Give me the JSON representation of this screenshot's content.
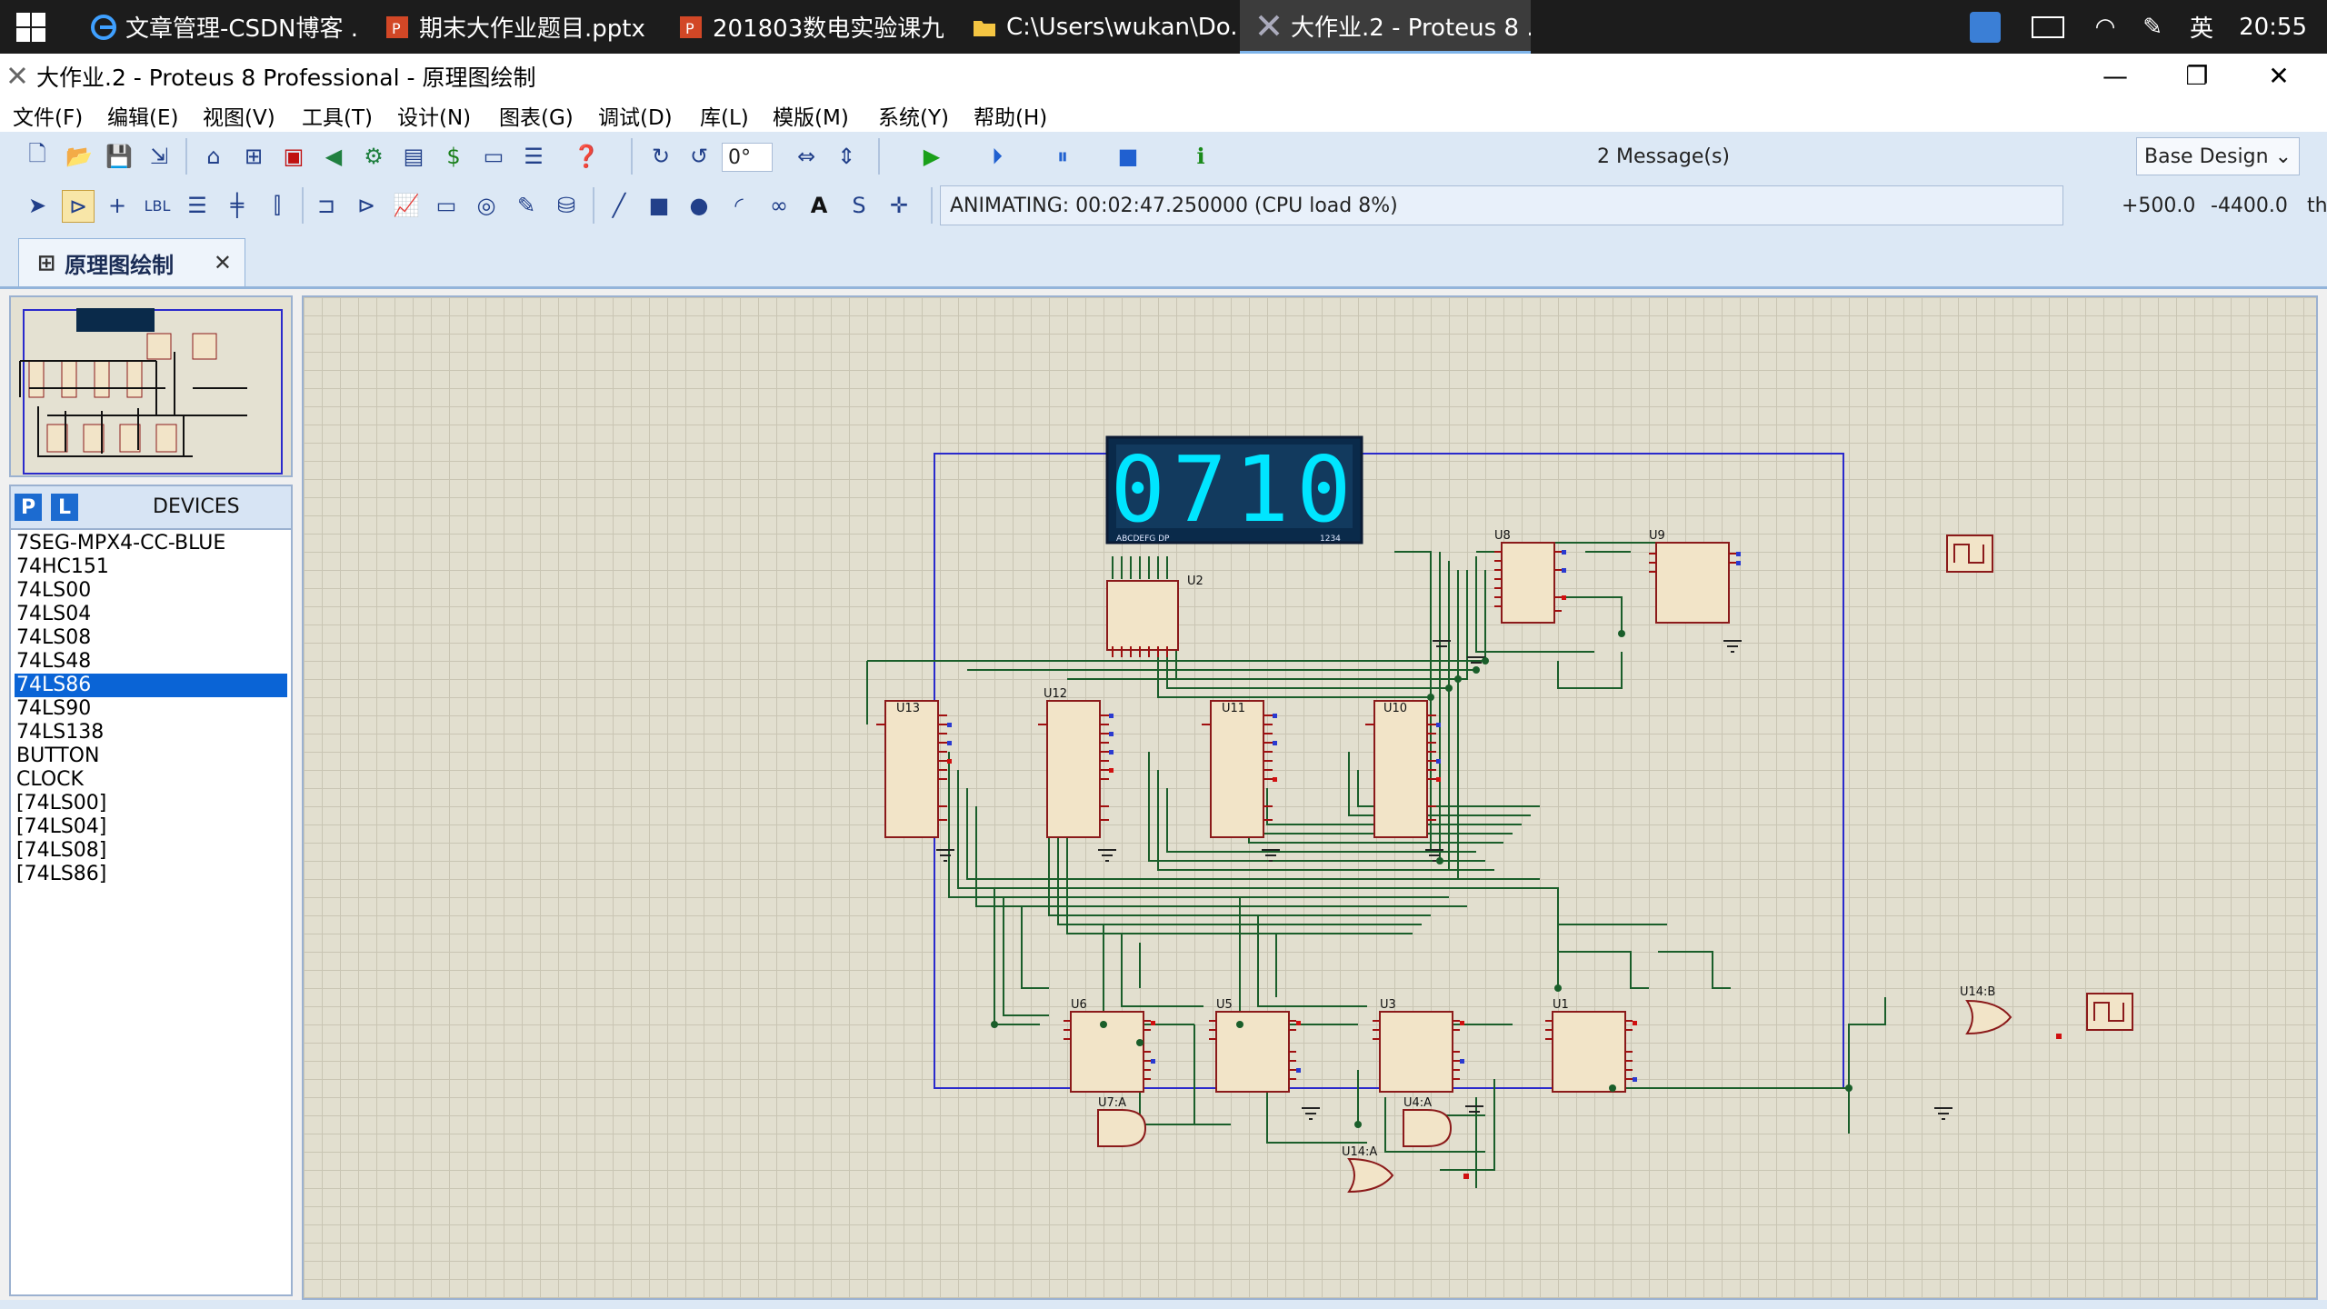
{
  "taskbar": {
    "items": [
      {
        "label": "文章管理-CSDN博客 ...",
        "icon": "edge-icon"
      },
      {
        "label": "期末大作业题目.pptx ...",
        "icon": "powerpoint-icon"
      },
      {
        "label": "201803数电实验课九...",
        "icon": "powerpoint-icon"
      },
      {
        "label": "C:\\Users\\wukan\\Do...",
        "icon": "folder-icon"
      },
      {
        "label": "大作业.2 - Proteus 8 ...",
        "icon": "proteus-icon"
      }
    ],
    "ime": "英",
    "clock": "20:55"
  },
  "window": {
    "title": "大作业.2 - Proteus 8 Professional - 原理图绘制"
  },
  "menu": [
    "文件(F)",
    "编辑(E)",
    "视图(V)",
    "工具(T)",
    "设计(N)",
    "图表(G)",
    "调试(D)",
    "库(L)",
    "模版(M)",
    "系统(Y)",
    "帮助(H)"
  ],
  "toolbar": {
    "rotation_value": "0°",
    "messages": "2 Message(s)",
    "design_select": "Base Design",
    "animating_status": "ANIMATING: 00:02:47.250000 (CPU load 8%)",
    "coord_x": "+500.0",
    "coord_y": "-4400.0",
    "units": "th"
  },
  "tab": {
    "label": "原理图绘制"
  },
  "devices": {
    "header": "DEVICES",
    "p_button": "P",
    "l_button": "L",
    "selected": "74LS86",
    "items": [
      "7SEG-MPX4-CC-BLUE",
      "74HC151",
      "74LS00",
      "74LS04",
      "74LS08",
      "74LS48",
      "74LS86",
      "74LS90",
      "74LS138",
      "BUTTON",
      "CLOCK",
      "[74LS00]",
      "[74LS04]",
      "[74LS08]",
      "[74LS86]"
    ]
  },
  "schematic": {
    "display_value": "0710",
    "components": [
      "U8",
      "U9",
      "U2",
      "U13",
      "U12",
      "U11",
      "U10",
      "U6",
      "U5",
      "U3",
      "U1",
      "U14:B",
      "U7:A",
      "U4:A",
      "U14:A"
    ],
    "colors": {
      "chip_fill": "#f2e4c8",
      "chip_border": "#8b1a1a",
      "wire": "#1a5e2a",
      "frame": "#2a2acc",
      "display_bg": "#0a2a4a",
      "display_digit": "#00e5ff"
    }
  }
}
